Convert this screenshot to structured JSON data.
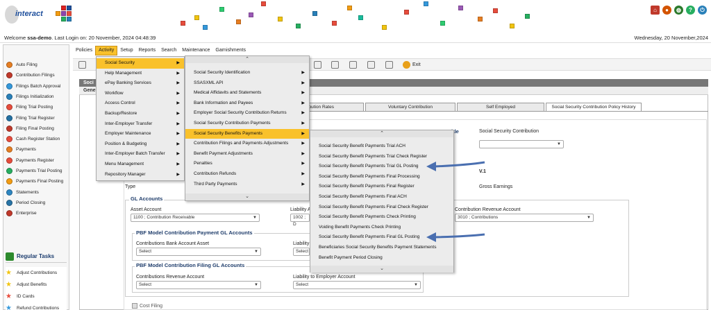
{
  "header": {
    "logo_text": "interact",
    "icons": [
      "home-icon",
      "users-icon",
      "globe-icon",
      "help-icon",
      "power-icon"
    ]
  },
  "welcome": {
    "prefix": "Welcome",
    "user": "ssa-demo",
    "last_login": ". Last Login on: 20 November, 2024 04:48:39",
    "date": "Wednesday, 20 November,2024"
  },
  "menubar": [
    "Policies",
    "Activity",
    "Setup",
    "Reports",
    "Search",
    "Maintenance",
    "Garnishments"
  ],
  "toolbar": {
    "exit_label": "Exit"
  },
  "sidebar": {
    "items": [
      "Auto Filing",
      "Contribution Filings",
      "Filings Batch Approval",
      "Filings Initialization",
      "Filing Trial Posting",
      "Filing Trial Register",
      "Filing Final Posting",
      "Cash Register Station",
      "Payments",
      "Payments Register",
      "Payments Trial Posting",
      "Payments Final Posting",
      "Statements",
      "Period Closing",
      "Enterprise"
    ],
    "regular_tasks_title": "Regular Tasks",
    "regular_tasks": [
      "Adjust Contributions",
      "Adjust Benefits",
      "ID Cards",
      "Refund Contributions"
    ]
  },
  "activity_menu": [
    "Social Security",
    "Help Management",
    "ePay Banking Services",
    "Workflow",
    "Access Control",
    "Backup/Restore",
    "Inter-Employer Transfer",
    "Employer Maintenance",
    "Position & Budgeting",
    "Inter-Employer Batch Transfer",
    "Menu Management",
    "Repository Manager"
  ],
  "social_security_menu": [
    "Social Security Identification",
    "SSASXML API",
    "Medical Affidavits and Statements",
    "Bank Information and Payees",
    "Employer Social Security Contribution Returns",
    "Social Security Contribution Payments",
    "Social Security Benefits Payments",
    "Contribution Filings and Payments Adjustments",
    "Benefit Payment Adjustments",
    "Penalties",
    "Contribution Refunds",
    "Third Party Payments"
  ],
  "benefits_menu": [
    "Social Security Benefit Payments Trial ACH",
    "Social Security Benefit Payments Trial Check Register",
    "Social Security Benefit Payments Trial GL Posting",
    "Social Security Benefit Payments Final Processing",
    "Social Security Benefit Payments Final Register",
    "Social Security Benefit Payments Final ACH",
    "Social Security Benefit Payments Final Check Register",
    "Social Security Benefit Payments Check Printing",
    "Voiding Benefit Payments Check Printing",
    "Social Security Benefit Payments Final GL Posting",
    "Beneficiaries Social Security Benefits Payment Statements",
    "Benefit Payment Period Closing"
  ],
  "main": {
    "header_left": "Soci",
    "sub_left": "Gene",
    "tabs": [
      "ibution Rates",
      "Voluntary Contribution",
      "Self Employed",
      "Social Security Contribution Policy History"
    ],
    "title_fragment": "itle",
    "ss_contribution_label": "Social Security Contribution",
    "version": "V.1",
    "type_label": "Type",
    "gross_earnings": "Gross Earnings",
    "gl_accounts": "GL Accounts",
    "asset_account_label": "Asset Account",
    "asset_account_value": "1100 ; Contribution Receivable",
    "liability_label": "Liability A",
    "liability_value": "1002 ; D",
    "contribution_revenue_label": "Contribution Revenue Account",
    "contribution_revenue_value": "3010 ; Contributions",
    "pbf_payment_title": "PBF Model Contribution Payment GL Accounts",
    "contrib_bank_label": "Contributions Bank Account Asset",
    "select": "Select",
    "liability_short": "Liability",
    "pbf_filing_title": "PBF Model Contribution Filing GL Accounts",
    "contrib_revenue_acc_label": "Contributions Revenue Account",
    "liability_employer_label": "Liability to Employer Account",
    "cost_filing": "Cost Filing"
  }
}
